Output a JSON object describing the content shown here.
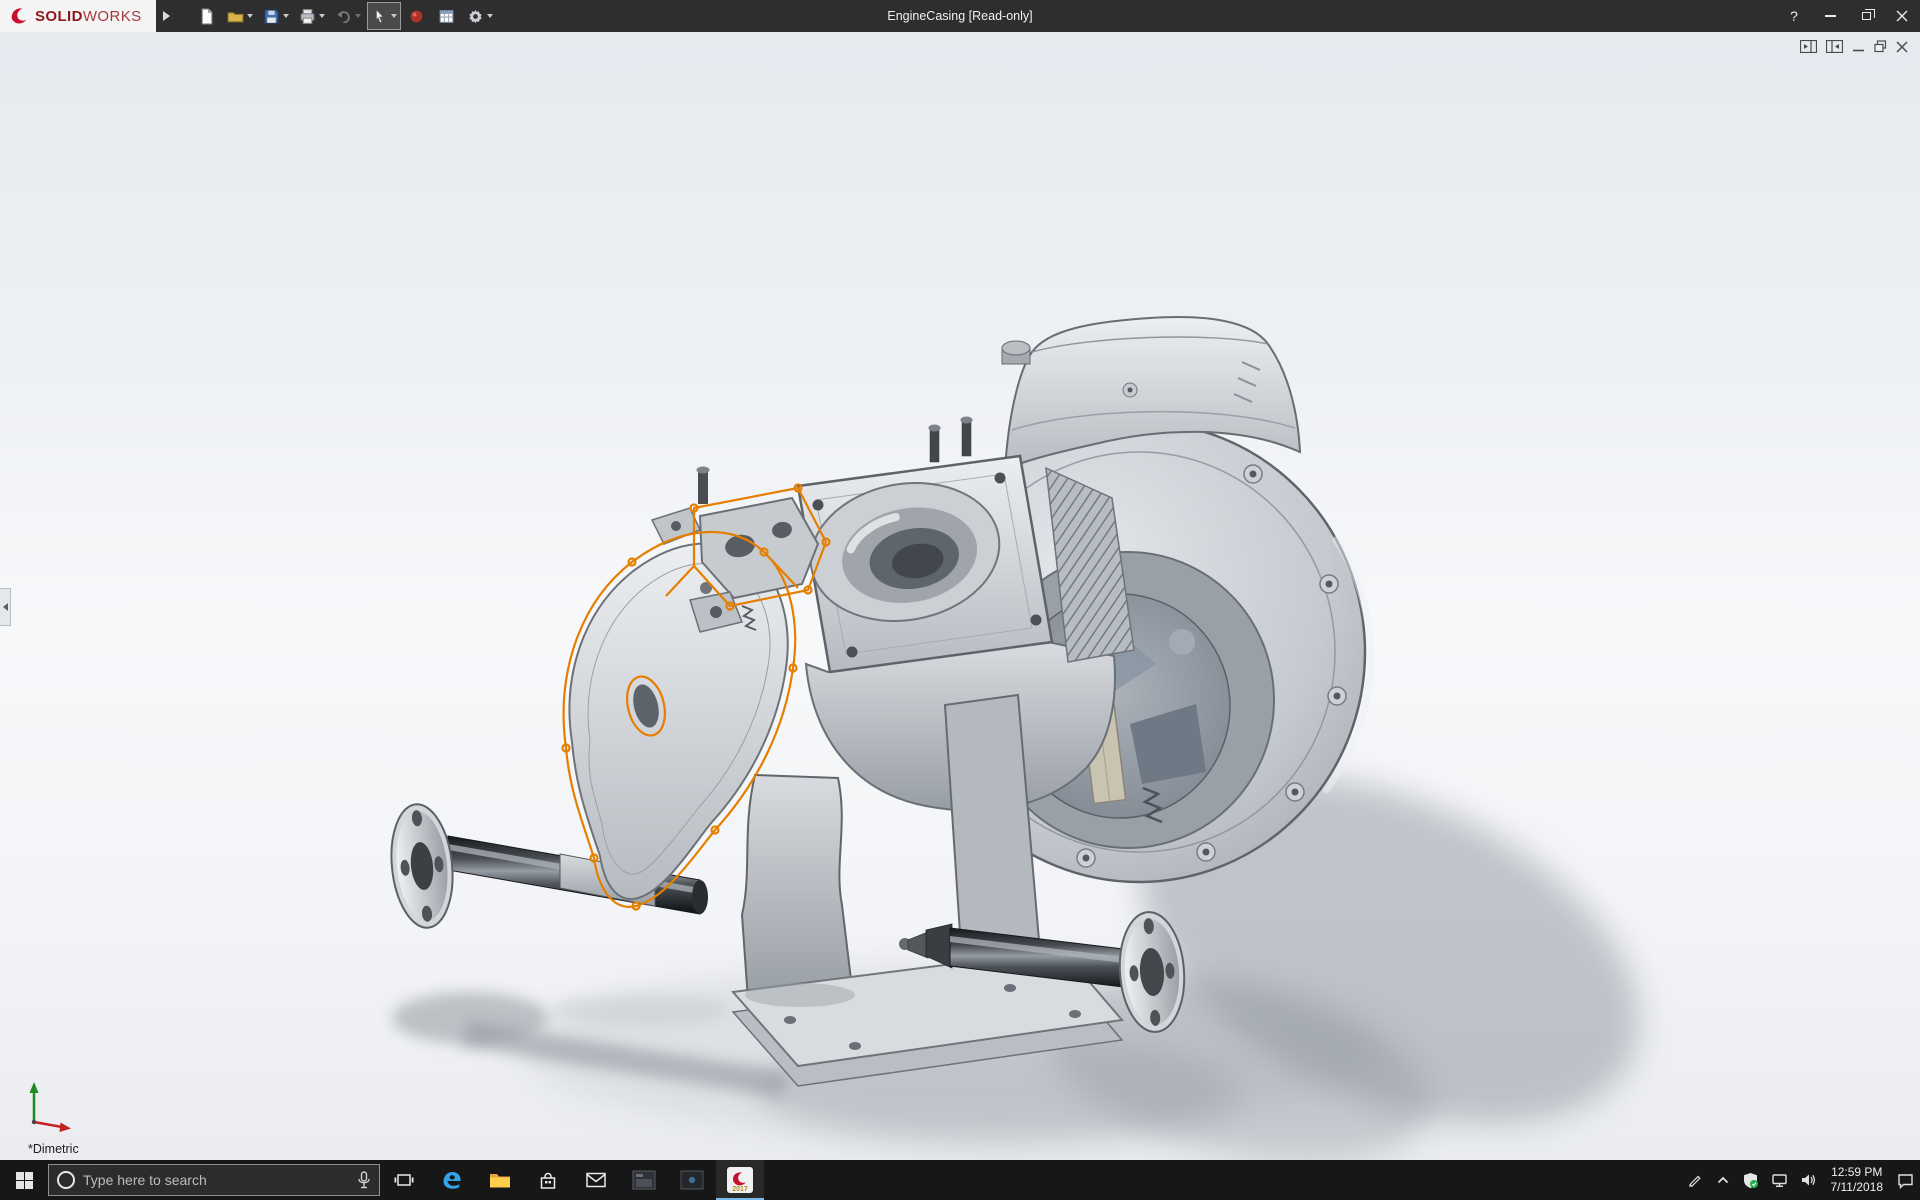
{
  "colors": {
    "titlebar_bg": "#2e2e2e",
    "brand_red": "#8b1a1e",
    "sketch_orange": "#e67e00",
    "taskbar_bg": "#171717",
    "accent_blue": "#76b9ed",
    "shield_green": "#23b14d",
    "edge_blue": "#35a3e8",
    "swirl_red": "#c8102e"
  },
  "titlebar": {
    "brand": {
      "solid": "SOLID",
      "works": "WORKS"
    },
    "title": "EngineCasing [Read-only]",
    "help_label": "?",
    "toolbar_items": [
      "new-document",
      "open",
      "save",
      "print",
      "undo",
      "select",
      "render-sphere",
      "design-table",
      "options"
    ],
    "window_controls": [
      "help",
      "minimize",
      "restore",
      "close"
    ]
  },
  "document_window": {
    "controls": [
      "show-left-pane",
      "show-right-pane",
      "minimize",
      "restore",
      "close"
    ]
  },
  "viewport": {
    "view_orientation": "*Dimetric",
    "triad_axes": [
      "y-green-up",
      "x-red-right"
    ]
  },
  "taskbar": {
    "search_placeholder": "Type here to search",
    "apps": [
      "start",
      "cortana-search",
      "microphone",
      "task-view",
      "edge",
      "file-explorer",
      "store",
      "mail",
      "media-app",
      "secondary-app",
      "solidworks-2017"
    ],
    "solidworks_badge": {
      "year": "2017"
    },
    "tray_icons": [
      "pen",
      "hidden-icons",
      "defender-shield",
      "network",
      "volume",
      "clock",
      "action-center"
    ],
    "tray": {
      "time": "12:59 PM",
      "date": "7/11/2018"
    }
  }
}
